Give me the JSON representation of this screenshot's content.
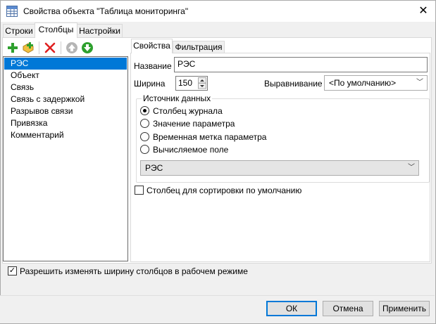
{
  "window": {
    "title": "Свойства объекта \"Таблица мониторинга\""
  },
  "tabs": [
    {
      "label": "Строки",
      "active": false
    },
    {
      "label": "Столбцы",
      "active": true
    },
    {
      "label": "Настройки",
      "active": false
    }
  ],
  "toolbar": {
    "add_icon": "add-green-plus-icon",
    "add_copy_icon": "add-copy-icon",
    "delete_icon": "delete-red-x-icon",
    "move_up_icon": "arrow-up-circle-icon",
    "move_down_icon": "arrow-down-circle-icon"
  },
  "columns": [
    {
      "label": "РЭС",
      "selected": true
    },
    {
      "label": "Объект",
      "selected": false
    },
    {
      "label": "Связь",
      "selected": false
    },
    {
      "label": "Связь с задержкой",
      "selected": false
    },
    {
      "label": "Разрывов связи",
      "selected": false
    },
    {
      "label": "Привязка",
      "selected": false
    },
    {
      "label": "Комментарий",
      "selected": false
    }
  ],
  "inner_tabs": [
    {
      "label": "Свойства",
      "active": true
    },
    {
      "label": "Фильтрация",
      "active": false
    }
  ],
  "properties": {
    "name_label": "Название",
    "name_value": "РЭС",
    "width_label": "Ширина",
    "width_value": "150",
    "align_label": "Выравнивание",
    "align_value": "<По умолчанию>",
    "source_group_label": "Источник данных",
    "sources": [
      {
        "label": "Столбец журнала",
        "checked": true
      },
      {
        "label": "Значение параметра",
        "checked": false
      },
      {
        "label": "Временная метка параметра",
        "checked": false
      },
      {
        "label": "Вычисляемое поле",
        "checked": false
      }
    ],
    "source_column_value": "РЭС",
    "default_sort_label": "Столбец для сортировки по умолчанию",
    "default_sort_checked": false
  },
  "allow_resize_label": "Разрешить изменять ширину столбцов в рабочем режиме",
  "allow_resize_checked": true,
  "buttons": {
    "ok": "ОК",
    "cancel": "Отмена",
    "apply": "Применить"
  },
  "colors": {
    "selection": "#0078d7",
    "add_green": "#2ea02e",
    "delete_red": "#e02020"
  }
}
